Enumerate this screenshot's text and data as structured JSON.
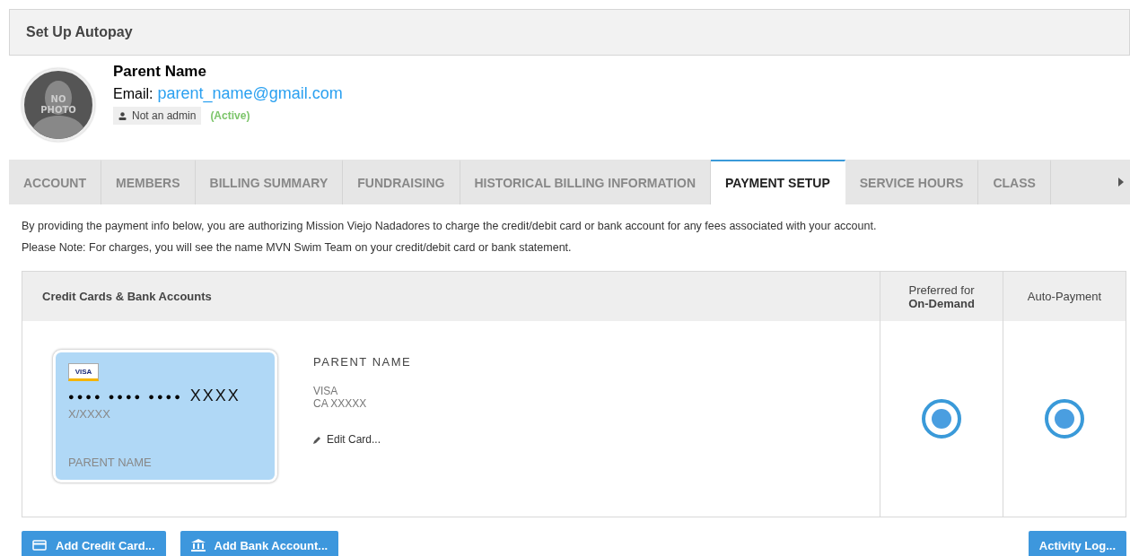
{
  "header": {
    "title": "Set Up Autopay"
  },
  "profile": {
    "name": "Parent Name",
    "email_label": "Email:",
    "email": "parent_name@gmail.com",
    "avatar_text": "NO PHOTO",
    "role": "Not an admin",
    "status": "(Active)"
  },
  "tabs": [
    {
      "label": "ACCOUNT",
      "selected": false
    },
    {
      "label": "MEMBERS",
      "selected": false
    },
    {
      "label": "BILLING SUMMARY",
      "selected": false
    },
    {
      "label": "FUNDRAISING",
      "selected": false
    },
    {
      "label": "HISTORICAL BILLING INFORMATION",
      "selected": false
    },
    {
      "label": "PAYMENT SETUP",
      "selected": true
    },
    {
      "label": "SERVICE HOURS",
      "selected": false
    },
    {
      "label": "CLASS",
      "selected": false
    }
  ],
  "notes": [
    "By providing the payment info below, you are authorizing Mission Viejo Nadadores to charge the credit/debit card or bank account for any fees associated with your account.",
    "Please Note: For charges, you will see the name MVN Swim Team on your credit/debit card or bank statement."
  ],
  "table": {
    "columns": [
      "Credit Cards & Bank Accounts",
      {
        "line1": "Preferred for",
        "line2": "On-Demand"
      },
      "Auto-Payment"
    ],
    "rows": [
      {
        "card": {
          "brand_badge": "VISA",
          "dots": "●●●● ●●●● ●●●●",
          "last4": "XXXX",
          "expiry": "X/XXXX",
          "holder": "PARENT NAME"
        },
        "holder": "PARENT NAME",
        "brand": "VISA",
        "location": "CA XXXXX",
        "edit": "Edit Card...",
        "preferred": true,
        "autopay": true
      }
    ]
  },
  "buttons": [
    {
      "label": "Add Credit Card...",
      "kind": "card"
    },
    {
      "label": "Add Bank Account...",
      "kind": "bank"
    },
    {
      "label": "Activity Log...",
      "kind": "plain"
    }
  ]
}
